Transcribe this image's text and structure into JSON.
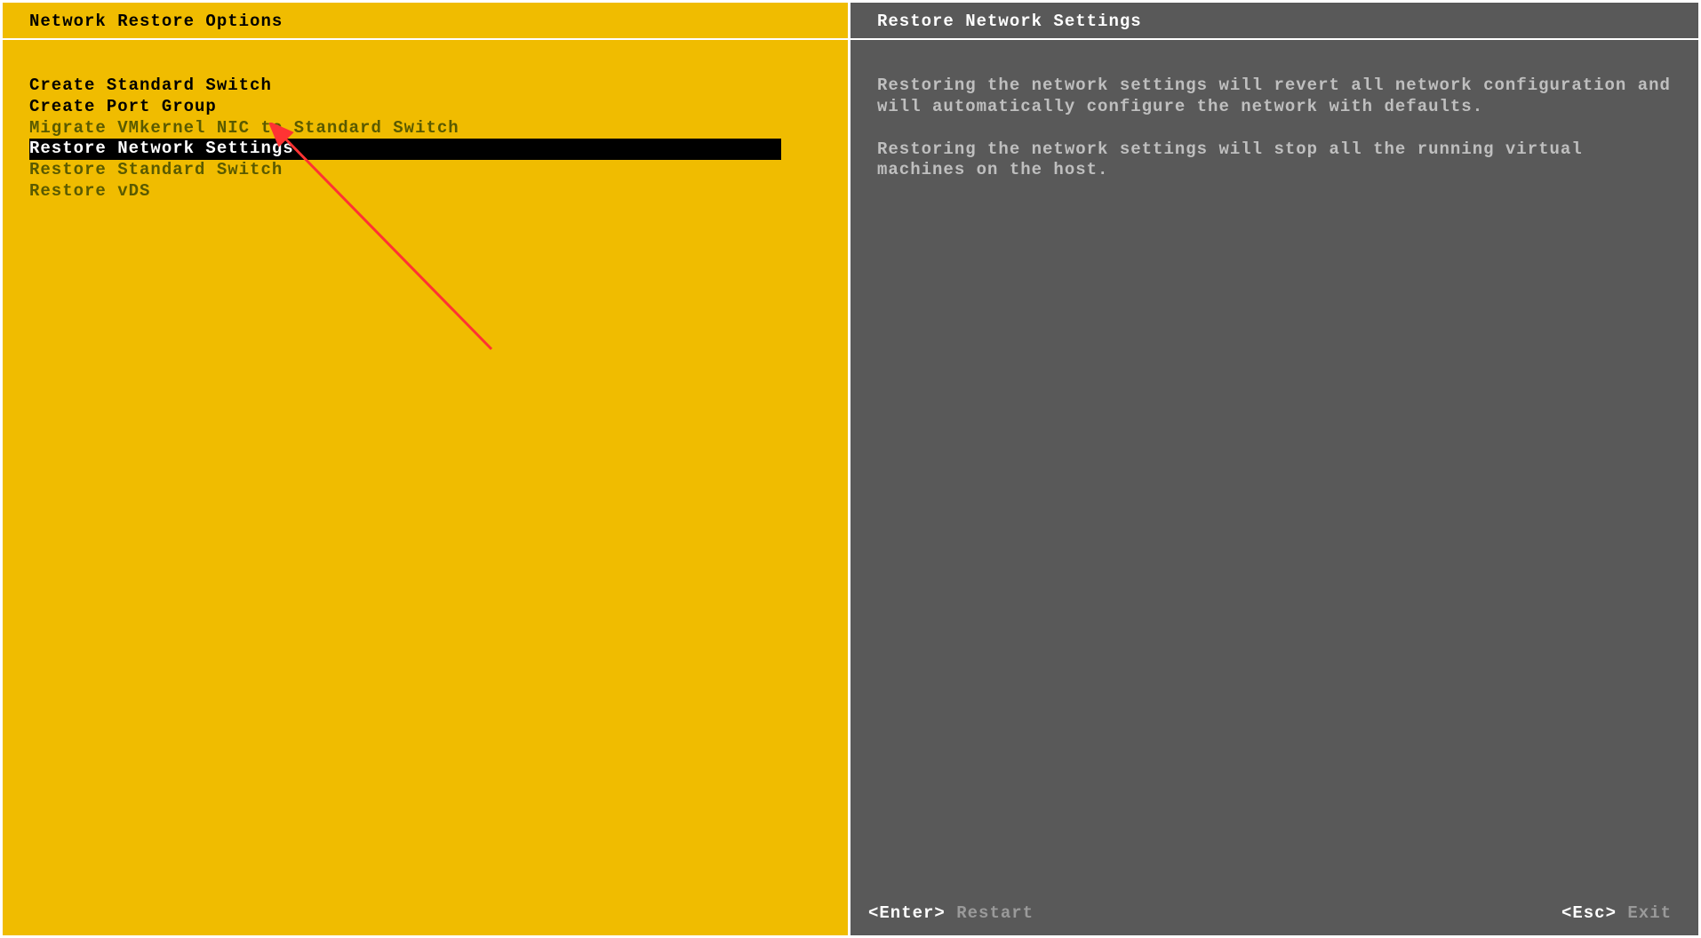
{
  "left_panel": {
    "title": "Network Restore Options",
    "menu_items": [
      {
        "label": "Create Standard Switch",
        "style": "bold",
        "selected": false
      },
      {
        "label": "Create Port Group",
        "style": "bold",
        "selected": false
      },
      {
        "label": "Migrate VMkernel NIC to Standard Switch",
        "style": "normal",
        "selected": false
      },
      {
        "label": "Restore Network Settings",
        "style": "bold",
        "selected": true
      },
      {
        "label": "Restore Standard Switch",
        "style": "normal",
        "selected": false
      },
      {
        "label": "Restore vDS",
        "style": "normal",
        "selected": false
      }
    ]
  },
  "right_panel": {
    "title": "Restore Network Settings",
    "paragraphs": [
      "Restoring the network settings will revert all network configuration and will automatically configure the network with defaults.",
      "Restoring the network settings will stop all the running virtual machines on the host."
    ],
    "footer": {
      "left": {
        "key": "<Enter>",
        "action": "Restart"
      },
      "right": {
        "key": "<Esc>",
        "action": "Exit"
      }
    }
  }
}
